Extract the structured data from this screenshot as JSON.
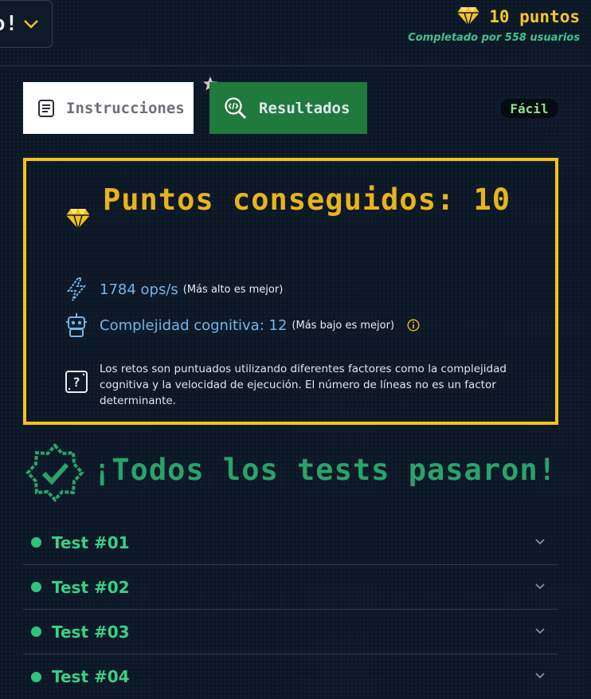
{
  "header": {
    "cut_button_text": "o!",
    "points": "10 puntos",
    "completed_by": "Completado por 558 usuarios"
  },
  "tabs": [
    {
      "label": "Instrucciones",
      "icon": "document-icon"
    },
    {
      "label": "Resultados",
      "icon": "code-search-icon"
    }
  ],
  "difficulty": "Fácil",
  "results": {
    "title": "Puntos conseguidos: 10",
    "ops_value": "1784 ops/s",
    "ops_note": "(Más alto es mejor)",
    "complexity_value": "Complejidad cognitiva: 12",
    "complexity_note": "(Más bajo es mejor)",
    "note": "Los retos son puntuados utilizando diferentes factores como la complejidad cognitiva y la velocidad de ejecución. El número de líneas no es un factor determinante."
  },
  "passed_title": "¡Todos los tests pasaron!",
  "tests": [
    {
      "label": "Test #01"
    },
    {
      "label": "Test #02"
    },
    {
      "label": "Test #03"
    },
    {
      "label": "Test #04"
    }
  ],
  "colors": {
    "background": "#0d1827",
    "accent_yellow": "#f2c31a",
    "success_green": "#2ec47a",
    "tab_active": "#1f7a3c",
    "metric_blue": "#6fb6ea"
  }
}
